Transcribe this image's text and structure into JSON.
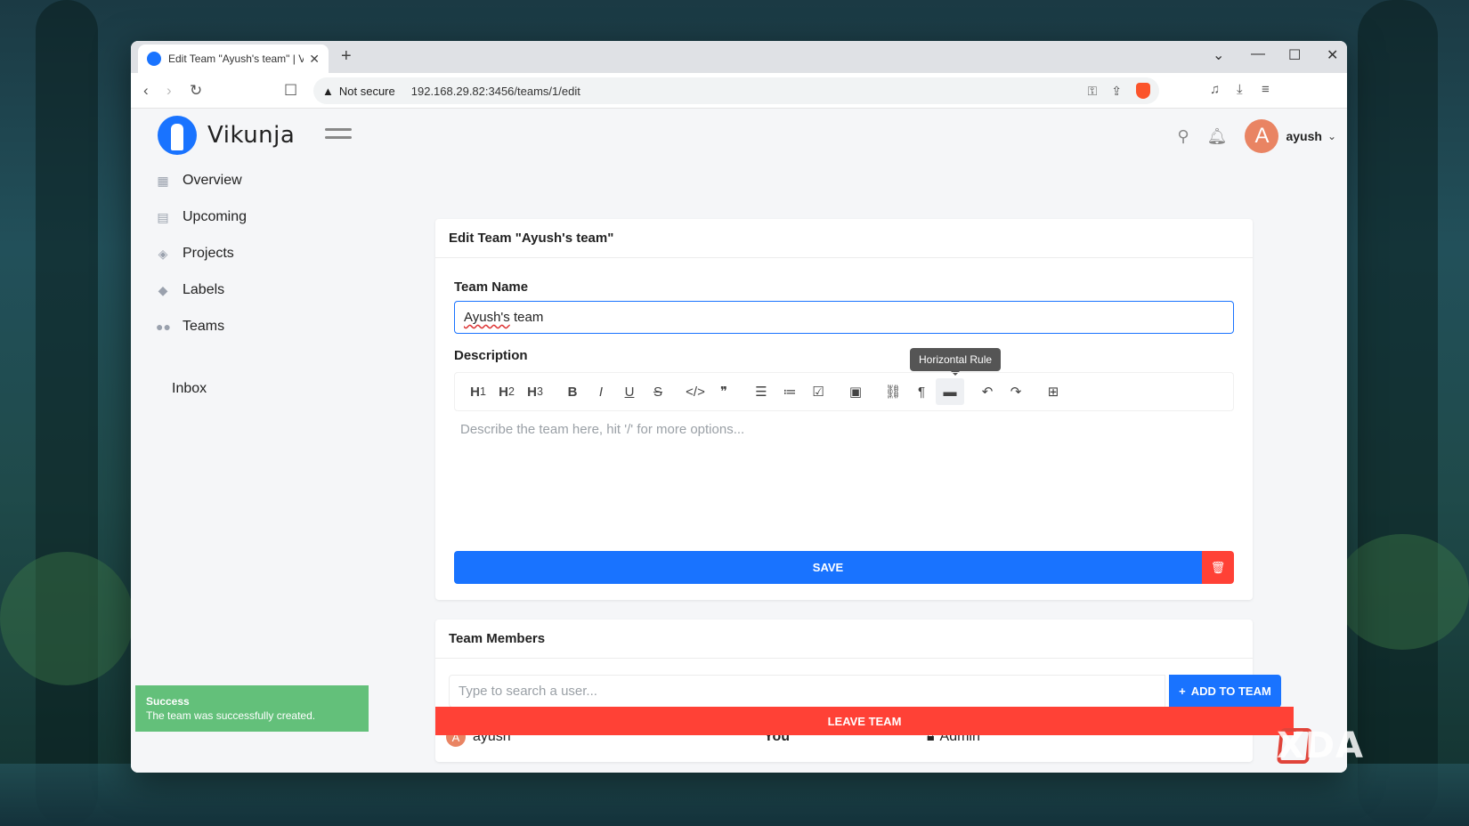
{
  "browser": {
    "tab_title": "Edit Team \"Ayush's team\" | Vik",
    "new_tab": "+",
    "security_label": "Not secure",
    "url": "192.168.29.82:3456/teams/1/edit"
  },
  "app": {
    "brand": "Vikunja",
    "username": "ayush",
    "avatar_letter": "A"
  },
  "sidebar": {
    "items": [
      {
        "label": "Overview",
        "icon": "calendar-icon"
      },
      {
        "label": "Upcoming",
        "icon": "calendar-week-icon"
      },
      {
        "label": "Projects",
        "icon": "layers-icon"
      },
      {
        "label": "Labels",
        "icon": "tags-icon"
      },
      {
        "label": "Teams",
        "icon": "users-icon"
      }
    ],
    "inbox": "Inbox"
  },
  "edit_team": {
    "title": "Edit Team \"Ayush's team\"",
    "name_label": "Team Name",
    "name_value_word": "Ayush's",
    "name_value_rest": " team",
    "description_label": "Description",
    "description_placeholder": "Describe the team here, hit '/' for more options...",
    "tooltip": "Horizontal Rule",
    "save_label": "SAVE"
  },
  "members": {
    "title": "Team Members",
    "search_placeholder": "Type to search a user...",
    "add_label": "ADD TO TEAM",
    "rows": [
      {
        "avatar": "A",
        "name": "ayush",
        "you_label": "You",
        "role": "Admin"
      }
    ],
    "leave_label": "LEAVE TEAM"
  },
  "toast": {
    "title": "Success",
    "message": "The team was successfully created."
  },
  "watermark": "XDA",
  "colors": {
    "primary": "#1973ff",
    "danger": "#ff4136",
    "success": "#63c07a"
  }
}
